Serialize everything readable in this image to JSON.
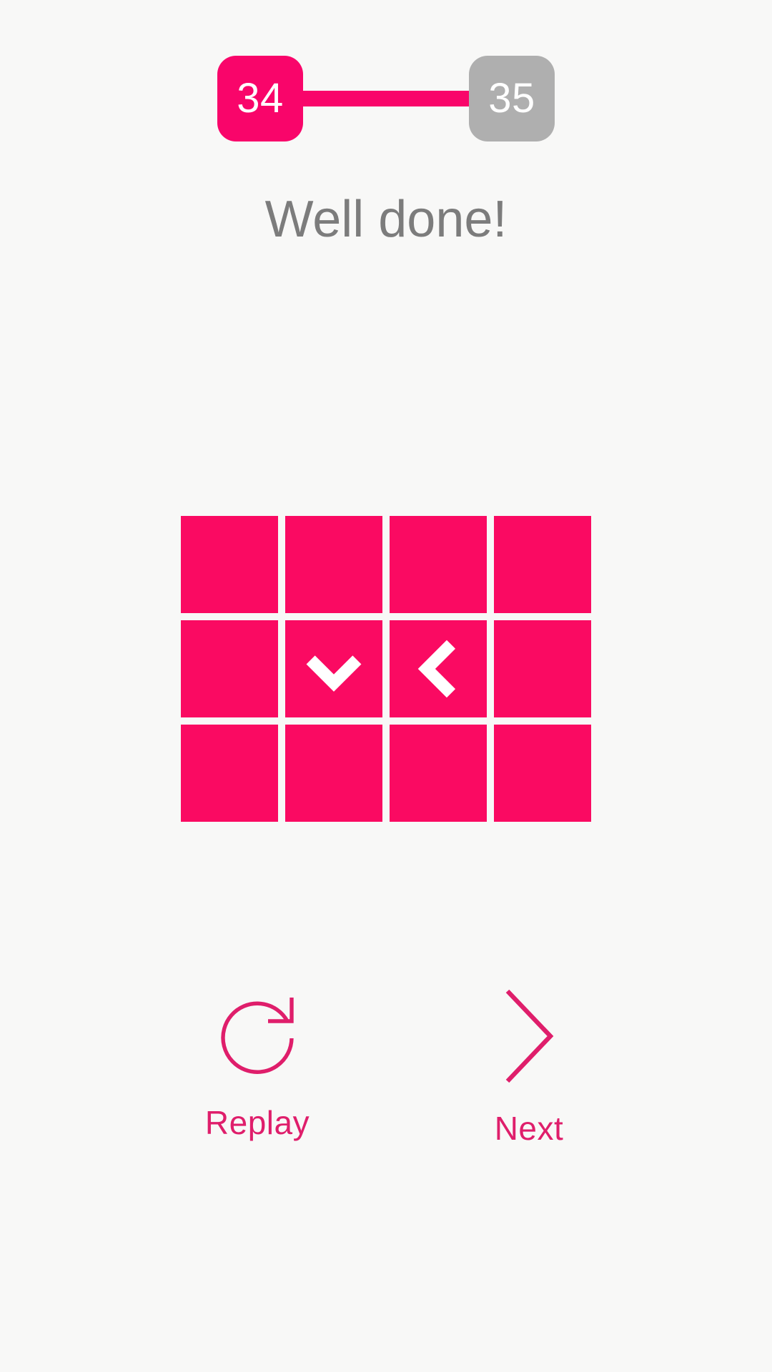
{
  "theme": {
    "background": "#F8F8F7",
    "accent_pink": "#FA0A62",
    "badge_pink": "#F9056A",
    "badge_gray": "#AFAFAF",
    "headline_gray": "#7C7C7C",
    "link_pink": "#DF1E6B",
    "tile_icon_color": "#FFFFFF"
  },
  "progress": {
    "current_step_label": "34",
    "next_step_label": "35",
    "connector_icon": "progress-connector-bar"
  },
  "headline": {
    "text": "Well done!"
  },
  "grid": {
    "columns": 4,
    "rows": 3,
    "tiles": [
      {
        "icon": "",
        "icon_name": "blank-tile"
      },
      {
        "icon": "",
        "icon_name": "blank-tile"
      },
      {
        "icon": "",
        "icon_name": "blank-tile"
      },
      {
        "icon": "",
        "icon_name": "blank-tile"
      },
      {
        "icon": "",
        "icon_name": "blank-tile"
      },
      {
        "icon": "chevron-down",
        "icon_name": "chevron-down-icon"
      },
      {
        "icon": "chevron-left",
        "icon_name": "chevron-left-icon"
      },
      {
        "icon": "",
        "icon_name": "blank-tile"
      },
      {
        "icon": "",
        "icon_name": "blank-tile"
      },
      {
        "icon": "",
        "icon_name": "blank-tile"
      },
      {
        "icon": "",
        "icon_name": "blank-tile"
      },
      {
        "icon": "",
        "icon_name": "blank-tile"
      }
    ]
  },
  "actions": {
    "replay": {
      "label": "Replay",
      "icon_name": "replay-circular-arrow-icon"
    },
    "next": {
      "label": "Next",
      "icon_name": "chevron-right-icon"
    }
  }
}
